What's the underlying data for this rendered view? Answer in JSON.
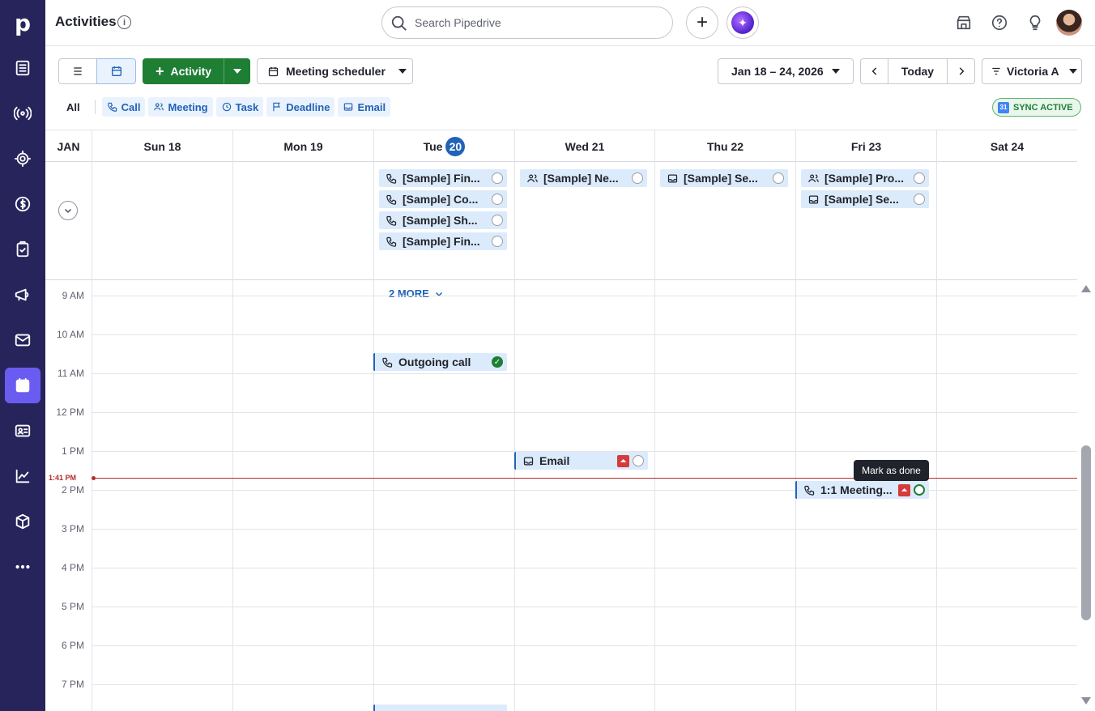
{
  "header": {
    "title": "Activities",
    "search_placeholder": "Search Pipedrive"
  },
  "nav": {
    "logo": "p"
  },
  "toolbar": {
    "add_activity": "Activity",
    "meeting_scheduler": "Meeting scheduler",
    "date_range": "Jan 18 – 24, 2026",
    "today": "Today",
    "user": "Victoria A"
  },
  "filters": {
    "all": "All",
    "call": "Call",
    "meeting": "Meeting",
    "task": "Task",
    "deadline": "Deadline",
    "email": "Email"
  },
  "sync": "SYNC ACTIVE",
  "calendar": {
    "month": "JAN",
    "days": [
      "Sun 18",
      "Mon 19",
      "Tue",
      "Wed 21",
      "Thu 22",
      "Fri 23",
      "Sat 24"
    ],
    "today_badge": "20",
    "allday": {
      "tue": [
        "[Sample] Fin...",
        "[Sample] Co...",
        "[Sample] Sh...",
        "[Sample] Fin..."
      ],
      "wed": [
        "[Sample] Ne..."
      ],
      "thu": [
        "[Sample] Se..."
      ],
      "fri": [
        "[Sample] Pro...",
        "[Sample] Se..."
      ]
    },
    "more": "2 MORE",
    "hours": [
      "9 AM",
      "10 AM",
      "11 AM",
      "12 PM",
      "1 PM",
      "2 PM",
      "3 PM",
      "4 PM",
      "5 PM",
      "6 PM",
      "7 PM"
    ],
    "now": "1:41 PM",
    "timed": {
      "outgoing": "Outgoing call",
      "email": "Email",
      "meeting": "1:1 Meeting..."
    },
    "tooltip": "Mark as done"
  },
  "colors": {
    "nav_bg": "#27245c",
    "active_nav": "#6a5cf0",
    "primary_green": "#1e7e34",
    "accent_blue": "#2063b8",
    "event_bg": "#dcebfb",
    "now_line": "#b32b2b"
  }
}
